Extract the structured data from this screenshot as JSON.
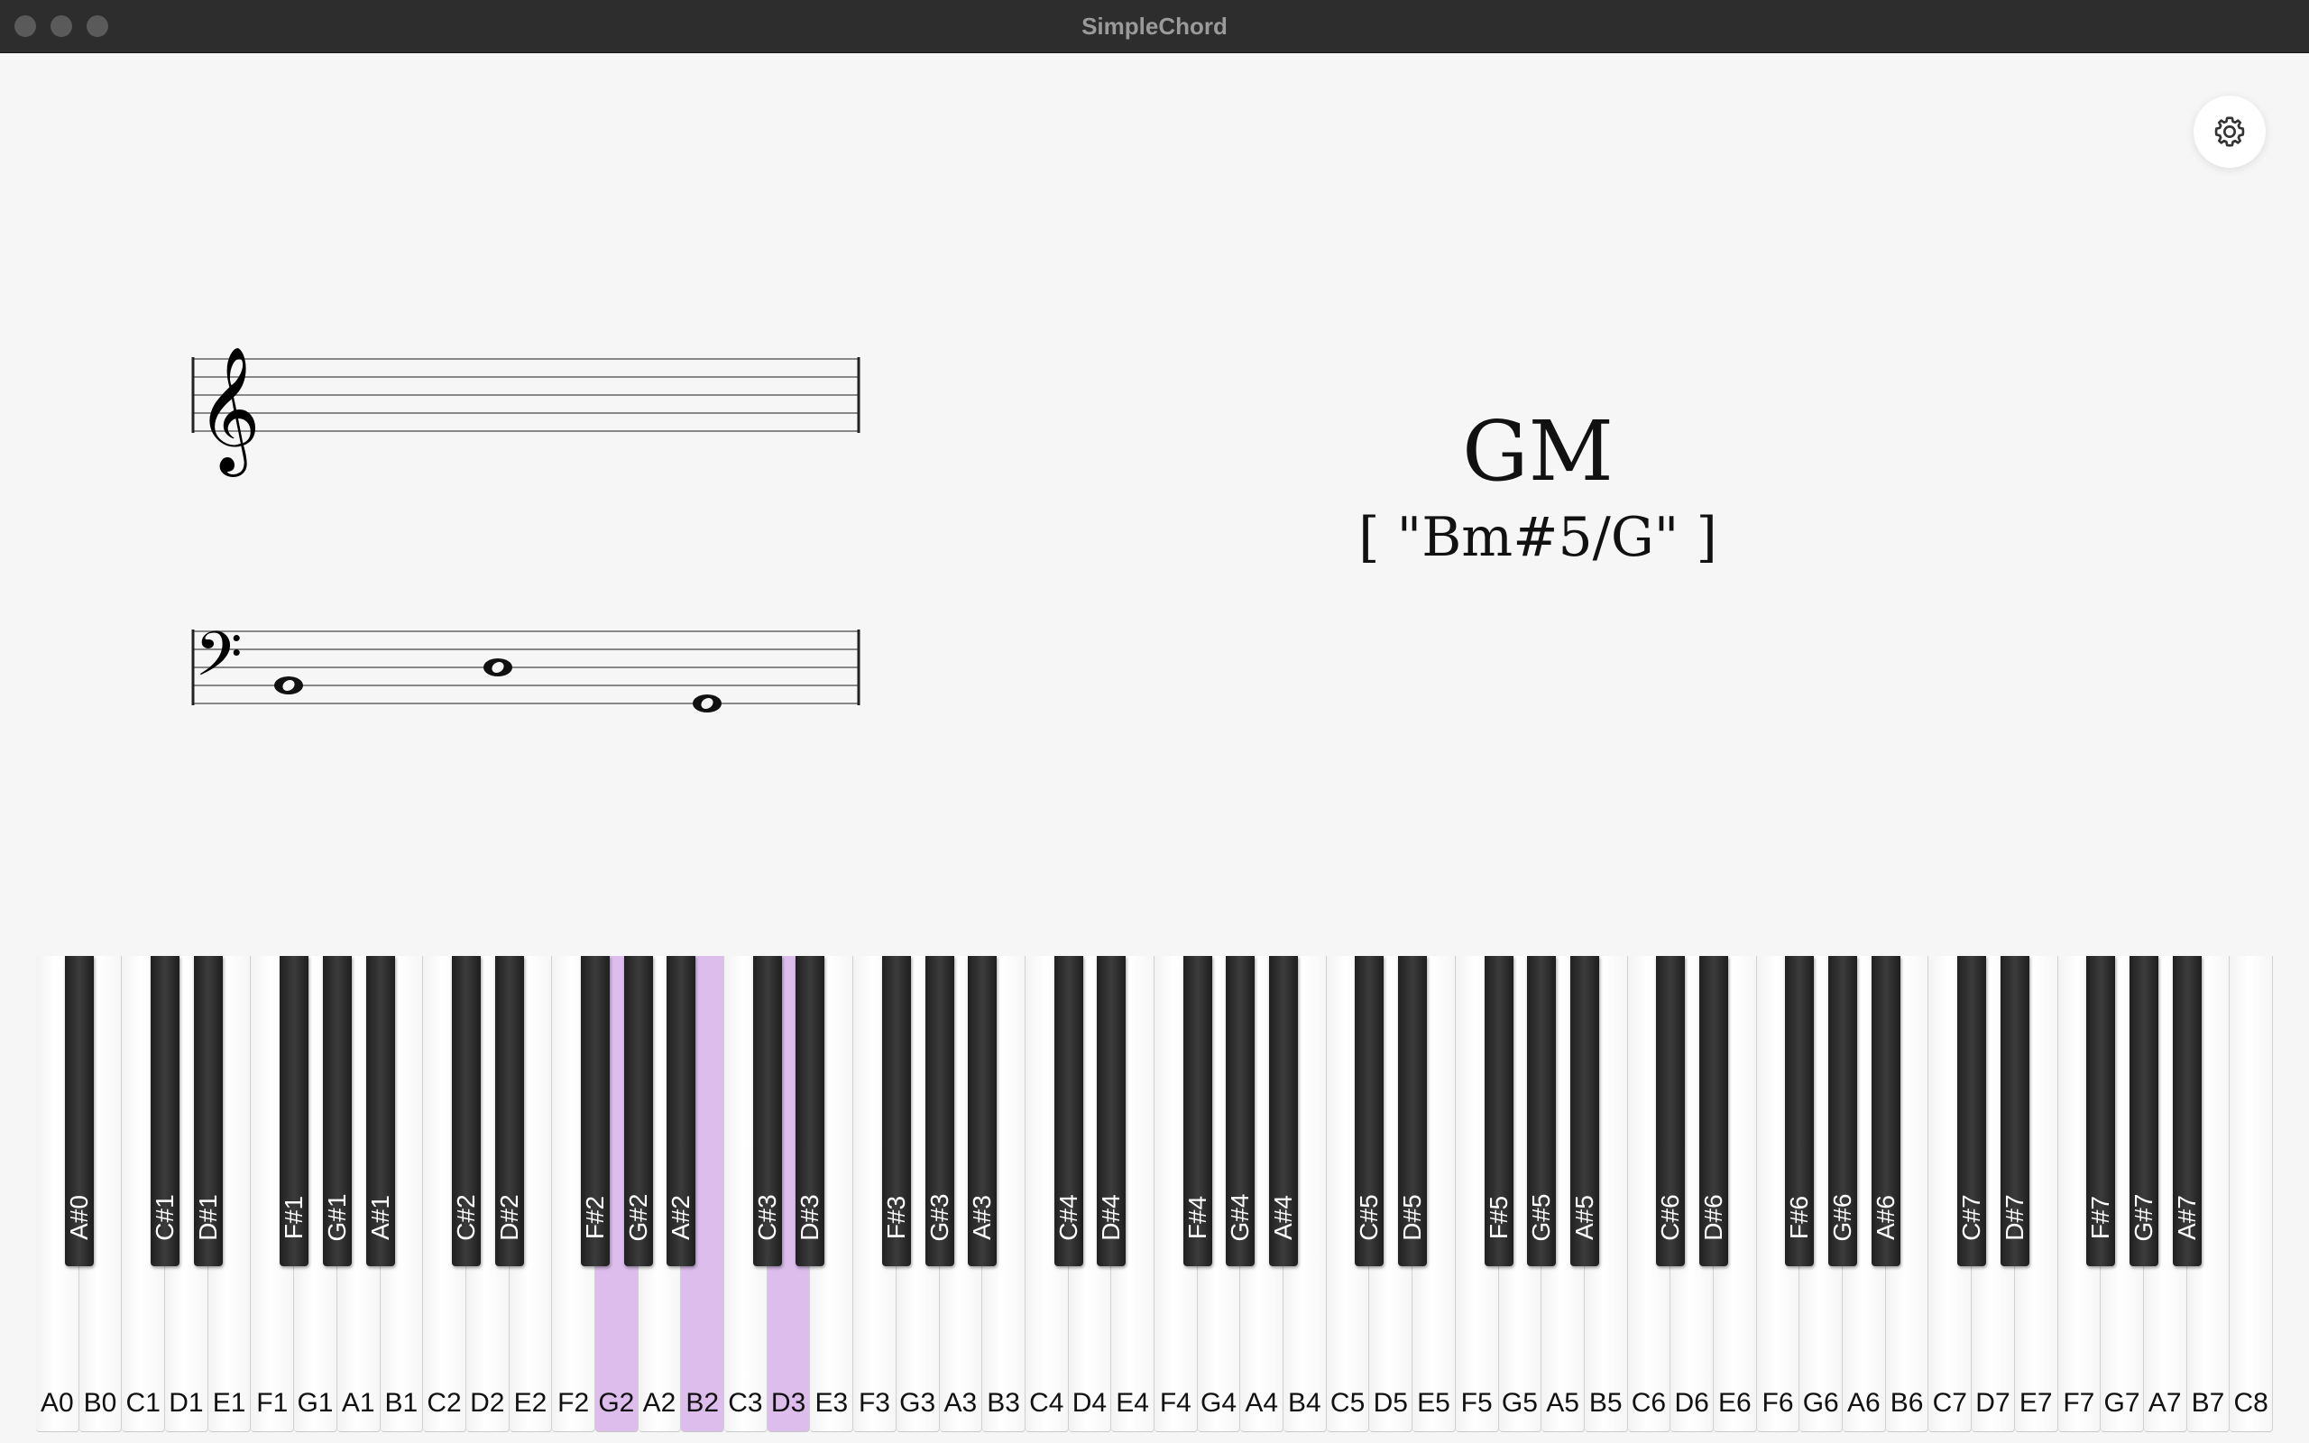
{
  "window": {
    "title": "SimpleChord"
  },
  "settings": {
    "icon": "gear-icon"
  },
  "notation": {
    "treble_clef": "𝄞",
    "bass_clef": "𝄢",
    "notes": [
      {
        "pitch": "G2",
        "staff": "bass"
      },
      {
        "pitch": "B2",
        "staff": "bass"
      },
      {
        "pitch": "D3",
        "staff": "bass"
      }
    ]
  },
  "chord": {
    "name": "GM",
    "alternatives": "[ \"Bm#5/G\" ]"
  },
  "keyboard": {
    "highlight_color": "#dcbdec",
    "white_keys": [
      "A0",
      "B0",
      "C1",
      "D1",
      "E1",
      "F1",
      "G1",
      "A1",
      "B1",
      "C2",
      "D2",
      "E2",
      "F2",
      "G2",
      "A2",
      "B2",
      "C3",
      "D3",
      "E3",
      "F3",
      "G3",
      "A3",
      "B3",
      "C4",
      "D4",
      "E4",
      "F4",
      "G4",
      "A4",
      "B4",
      "C5",
      "D5",
      "E5",
      "F5",
      "G5",
      "A5",
      "B5",
      "C6",
      "D6",
      "E6",
      "F6",
      "G6",
      "A6",
      "B6",
      "C7",
      "D7",
      "E7",
      "F7",
      "G7",
      "A7",
      "B7",
      "C8"
    ],
    "black_keys": [
      "A#0",
      "C#1",
      "D#1",
      "F#1",
      "G#1",
      "A#1",
      "C#2",
      "D#2",
      "F#2",
      "G#2",
      "A#2",
      "C#3",
      "D#3",
      "F#3",
      "G#3",
      "A#3",
      "C#4",
      "D#4",
      "F#4",
      "G#4",
      "A#4",
      "C#5",
      "D#5",
      "F#5",
      "G#5",
      "A#5",
      "C#6",
      "D#6",
      "F#6",
      "G#6",
      "A#6",
      "C#7",
      "D#7",
      "F#7",
      "G#7",
      "A#7"
    ],
    "active_keys": [
      "G2",
      "B2",
      "D3"
    ]
  }
}
